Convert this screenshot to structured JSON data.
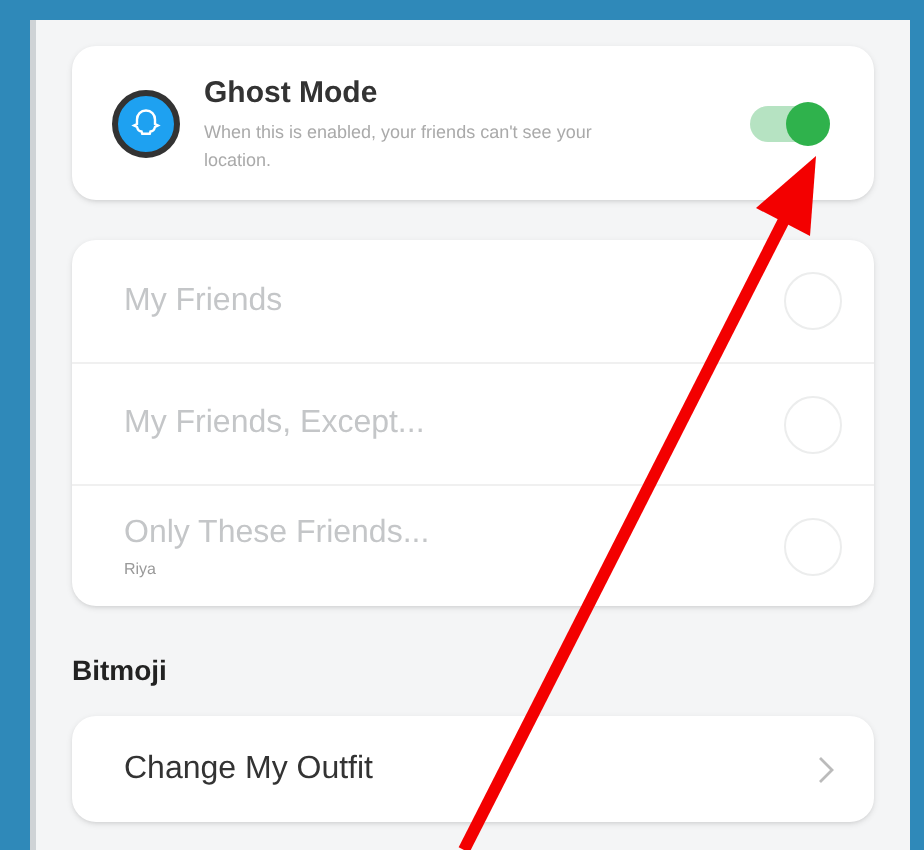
{
  "ghost_mode": {
    "title": "Ghost Mode",
    "description": "When this is enabled, your friends can't see your location.",
    "on": true
  },
  "visibility_options": [
    {
      "label": "My Friends",
      "selected": false,
      "disabled": true
    },
    {
      "label": "My Friends, Except...",
      "selected": false,
      "disabled": true
    },
    {
      "label": "Only These Friends...",
      "sublabel": "Riya",
      "selected": false,
      "disabled": true
    }
  ],
  "bitmoji": {
    "heading": "Bitmoji",
    "items": [
      {
        "label": "Change My Outfit"
      }
    ]
  }
}
